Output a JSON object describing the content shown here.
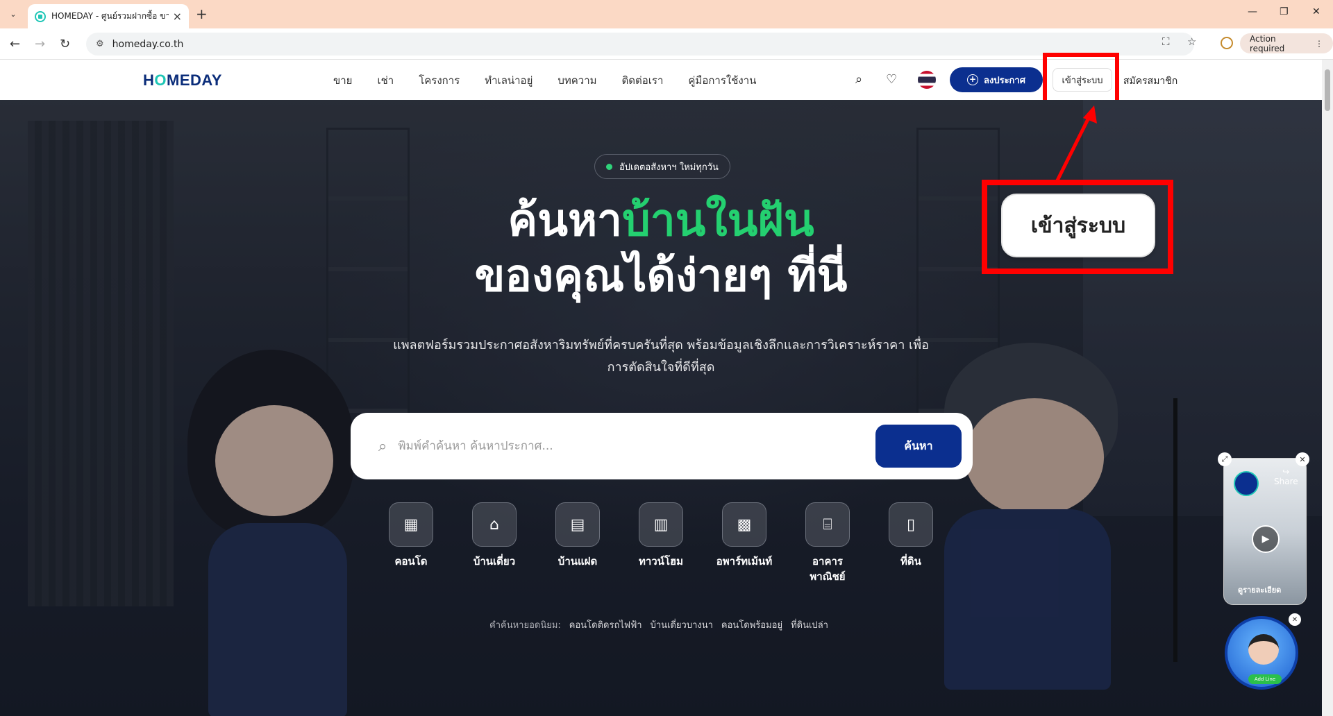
{
  "browser": {
    "tab_title": "HOMEDAY - ศูนย์รวมฝากซื้อ ขาย เ",
    "url": "homeday.co.th",
    "action_required": "Action required"
  },
  "site": {
    "logo": {
      "before": "H",
      "o": "O",
      "after": "MEDAY"
    },
    "nav": [
      "ขาย",
      "เช่า",
      "โครงการ",
      "ทำเลน่าอยู่",
      "บทความ",
      "ติดต่อเรา",
      "คู่มือการใช้งาน"
    ],
    "post_button": "ลงประกาศ",
    "login_button": "เข้าสู่ระบบ",
    "register": "สมัครสมาชิก"
  },
  "hero": {
    "badge": "อัปเดตอสังหาฯ ใหม่ทุกวัน",
    "title_line1_white": "ค้นหา",
    "title_line1_green": "บ้านในฝัน",
    "title_line2": "ของคุณได้ง่ายๆ ที่นี่",
    "subtitle": "แพลตฟอร์มรวมประกาศอสังหาริมทรัพย์ที่ครบครันที่สุด พร้อมข้อมูลเชิงลึกและการวิเคราะห์ราคา เพื่อการตัดสินใจที่ดีที่สุด",
    "search_placeholder": "พิมพ์คำค้นหา ค้นหาประกาศ...",
    "search_button": "ค้นหา",
    "categories": [
      {
        "label": "คอนโด",
        "icon": "building-icon"
      },
      {
        "label": "บ้านเดี่ยว",
        "icon": "house-icon"
      },
      {
        "label": "บ้านแฝด",
        "icon": "twin-house-icon"
      },
      {
        "label": "ทาวน์โฮม",
        "icon": "townhome-icon"
      },
      {
        "label": "อพาร์ทเม้นท์",
        "icon": "apartment-icon"
      },
      {
        "label": "อาคารพาณิชย์",
        "icon": "storefront-icon"
      },
      {
        "label": "ที่ดิน",
        "icon": "map-icon"
      }
    ],
    "popular_label": "คำค้นหายอดนิยม:",
    "popular": [
      "คอนโดติดรถไฟฟ้า",
      "บ้านเดี่ยวบางนา",
      "คอนโดพร้อมอยู่",
      "ที่ดินเปล่า"
    ]
  },
  "callout": {
    "label": "เข้าสู่ระบบ"
  },
  "video_widget": {
    "share": "Share",
    "detail": "ดูรายละเอียด"
  },
  "line_bot": {
    "tag": "Add Line"
  },
  "colors": {
    "brand_navy": "#0b2f8f",
    "accent_green": "#24d070",
    "highlight_red": "#ff0000"
  }
}
